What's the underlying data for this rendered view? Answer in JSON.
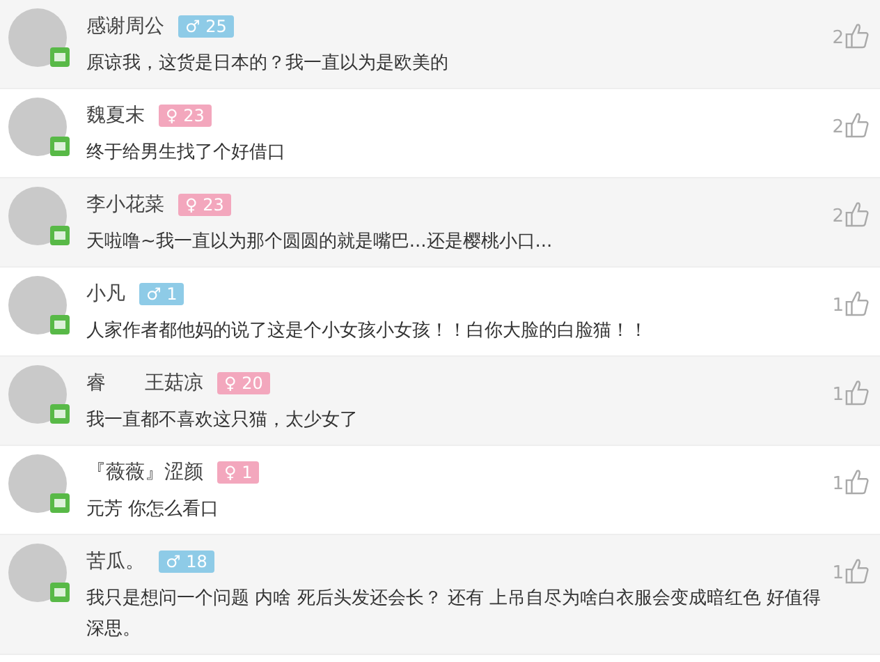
{
  "comments": [
    {
      "names": [
        "感谢周公"
      ],
      "kind": "male",
      "badge": "♂ 25",
      "text": "原谅我，这货是日本的？我一直以为是欧美的",
      "likes": "2"
    },
    {
      "names": [
        "魏夏末"
      ],
      "kind": "female",
      "badge": "♀ 23",
      "text": "终于给男生找了个好借口",
      "likes": "2"
    },
    {
      "names": [
        "李小花菜"
      ],
      "kind": "female",
      "badge": "♀ 23",
      "text": "天啦噜~我一直以为那个圆圆的就是嘴巴...还是樱桃小口...",
      "likes": "2"
    },
    {
      "names": [
        "小凡"
      ],
      "kind": "male",
      "badge": "♂ 1",
      "text": "人家作者都他妈的说了这是个小女孩小女孩！！白你大脸的白脸猫！！",
      "likes": "1"
    },
    {
      "names": [
        "睿",
        "王菇凉"
      ],
      "kind": "female",
      "badge": "♀ 20",
      "text": "我一直都不喜欢这只猫，太少女了",
      "likes": "1"
    },
    {
      "names": [
        "『薇薇』涩颜"
      ],
      "kind": "female",
      "badge": "♀ 1",
      "text": "元芳 你怎么看口",
      "likes": "1"
    },
    {
      "names": [
        "苦瓜。"
      ],
      "kind": "male",
      "badge": "♂ 18",
      "text": "我只是想问一个问题 内啥 死后头发还会长？ 还有 上吊自尽为啥白衣服会变成暗红色 好值得深思。",
      "likes": "1"
    }
  ]
}
